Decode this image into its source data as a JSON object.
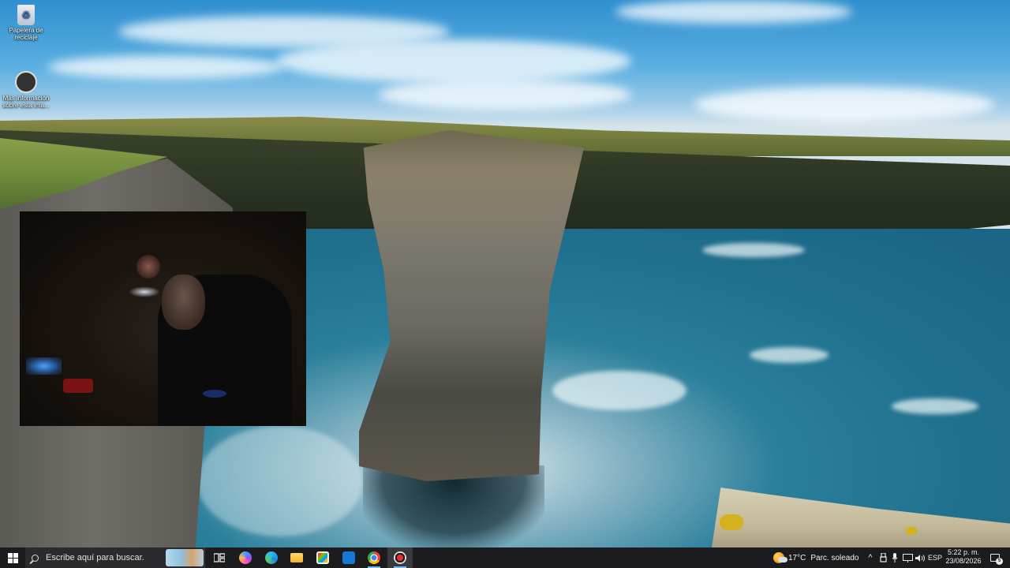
{
  "desktop": {
    "icons": [
      {
        "label": "Papelera de reciclaje",
        "icon": "recycle-bin-icon"
      },
      {
        "label": "Más información sobre esta ima...",
        "icon": "info-circle-icon"
      }
    ]
  },
  "webcam_overlay": {
    "icon": "webcam-feed"
  },
  "taskbar": {
    "search": {
      "placeholder": "Escribe aquí para buscar."
    },
    "apps": [
      {
        "name": "task-view",
        "icon": "task-view-icon"
      },
      {
        "name": "copilot",
        "icon": "copilot-icon"
      },
      {
        "name": "edge",
        "icon": "edge-icon"
      },
      {
        "name": "file-explorer",
        "icon": "folder-icon"
      },
      {
        "name": "microsoft-store",
        "icon": "store-icon"
      },
      {
        "name": "mail",
        "icon": "mail-icon"
      },
      {
        "name": "chrome",
        "icon": "chrome-icon"
      },
      {
        "name": "recorder",
        "icon": "recorder-icon"
      }
    ],
    "weather": {
      "temperature": "17°C",
      "condition": "Parc. soleado"
    },
    "tray": {
      "language": "ESP",
      "chevron": "^"
    },
    "clock": {
      "time": "5:22 p. m.",
      "date": "23/08/2026"
    },
    "notifications": {
      "count": "5"
    }
  },
  "colors": {
    "taskbar_bg": "#1c1c1f",
    "accent": "#76b9ed"
  }
}
